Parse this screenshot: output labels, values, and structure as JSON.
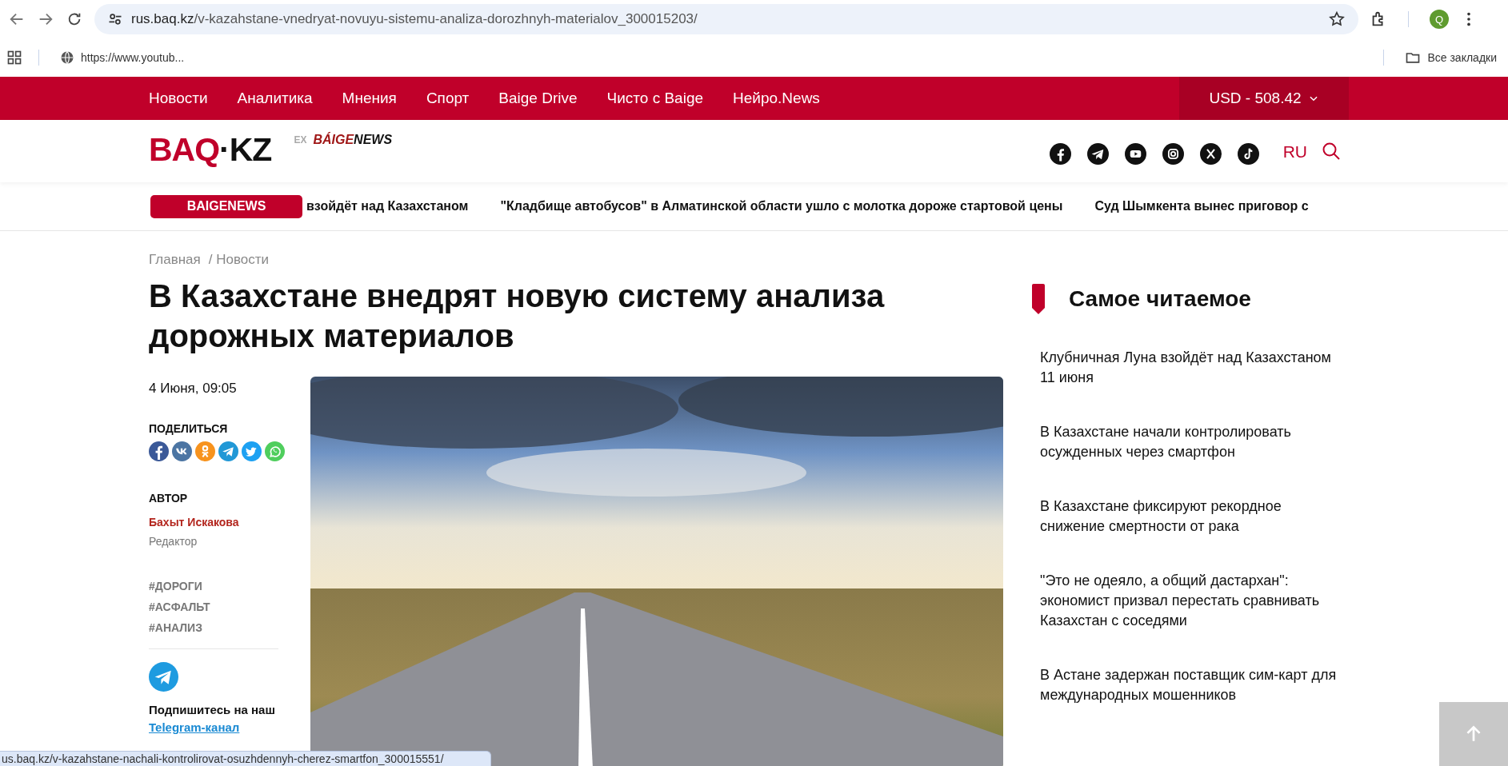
{
  "browser": {
    "url_host": "rus.baq.kz",
    "url_path": "/v-kazahstane-vnedryat-novuyu-sistemu-analiza-dorozhnyh-materialov_300015203/",
    "profile_initial": "Q",
    "bookmarks": [
      {
        "kind": "site",
        "label": "https://www.youtub..."
      }
    ],
    "all_bookmarks": "Все закладки"
  },
  "nav": {
    "items": [
      "Новости",
      "Аналитика",
      "Мнения",
      "Спорт",
      "Baige Drive",
      "Чисто с Baige",
      "Нейро.News"
    ],
    "currency": "USD - 508.42"
  },
  "header": {
    "logo": [
      {
        "text": "BAQ",
        "accent": true
      },
      {
        "text": "·",
        "accent": false
      },
      {
        "text": "KZ",
        "accent": false
      }
    ],
    "ex_label": "EX",
    "sublogo": [
      {
        "text": "BÁIGE",
        "accent": true
      },
      {
        "text": "NEWS",
        "accent": false
      }
    ],
    "social": [
      {
        "kind": "facebook"
      },
      {
        "kind": "telegram"
      },
      {
        "kind": "youtube"
      },
      {
        "kind": "instagram"
      },
      {
        "kind": "x"
      },
      {
        "kind": "tiktok"
      }
    ],
    "language": {
      "label": "RU",
      "selected": true
    }
  },
  "ticker": {
    "badge": "BAIGENEWS",
    "items": [
      "взойдёт над Казахстаном",
      "\"Кладбище автобусов\" в Алматинской области ушло с молотка дороже стартовой цены",
      "Суд Шымкента вынес приговор с"
    ]
  },
  "breadcrumbs": [
    "Главная",
    "/ Новости"
  ],
  "article": {
    "title": "В Казахстане внедрят новую систему анализа дорожных материалов",
    "date": "4 Июня, 09:05",
    "share_label": "ПОДЕЛИТЬСЯ",
    "share": [
      {
        "kind": "facebook",
        "color": "#3b5998"
      },
      {
        "kind": "vk",
        "color": "#4c75a3"
      },
      {
        "kind": "ok",
        "color": "#f7931e"
      },
      {
        "kind": "telegram",
        "color": "#2198d6"
      },
      {
        "kind": "twitter",
        "color": "#1da1f2"
      },
      {
        "kind": "whatsapp",
        "color": "#4fce5d"
      }
    ],
    "author_label": "АВТОР",
    "author": "Бахыт Искакова",
    "author_role": "Редактор",
    "tags": [
      "#ДОРОГИ",
      "#АСФАЛЬТ",
      "#АНАЛИЗ"
    ],
    "subscribe_text": "Подпишитесь на наш",
    "subscribe_link": "Telegram-канал"
  },
  "most_read": {
    "title": "Самое читаемое",
    "items": [
      "Клубничная Луна взойдёт над Казахстаном 11 июня",
      "В Казахстане начали контролировать осужденных через смартфон",
      "В Казахстане фиксируют рекордное снижение смертности от рака",
      "\"Это не одеяло, а общий дастархан\": экономист призвал перестать сравнивать Казахстан с соседями",
      "В Астане задержан поставщик сим-карт для международных мошенников"
    ]
  },
  "status_url": "us.baq.kz/v-kazahstane-nachali-kontrolirovat-osuzhdennyh-cherez-smartfon_300015551/"
}
